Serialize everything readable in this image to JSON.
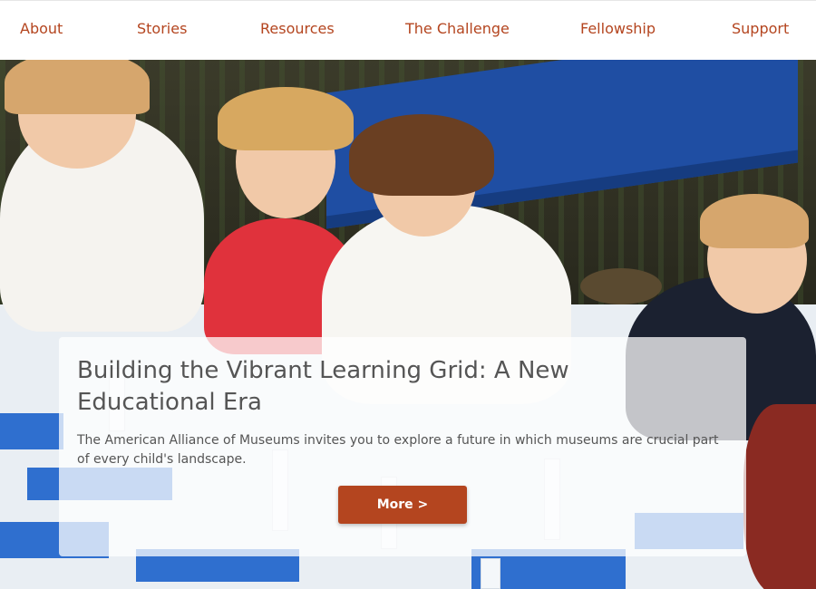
{
  "nav": {
    "items": [
      {
        "label": "About"
      },
      {
        "label": "Stories"
      },
      {
        "label": "Resources"
      },
      {
        "label": "The Challenge"
      },
      {
        "label": "Fellowship"
      },
      {
        "label": "Support"
      }
    ]
  },
  "hero": {
    "title": "Building the Vibrant Learning Grid: A New Educational Era",
    "description": "The American Alliance of Museums invites you to explore a future in which museums are crucial part of every child's landscape.",
    "button_label": "More >"
  },
  "colors": {
    "accent": "#b4451f",
    "card_text": "#555555",
    "card_bg": "rgba(255,255,255,0.74)"
  }
}
